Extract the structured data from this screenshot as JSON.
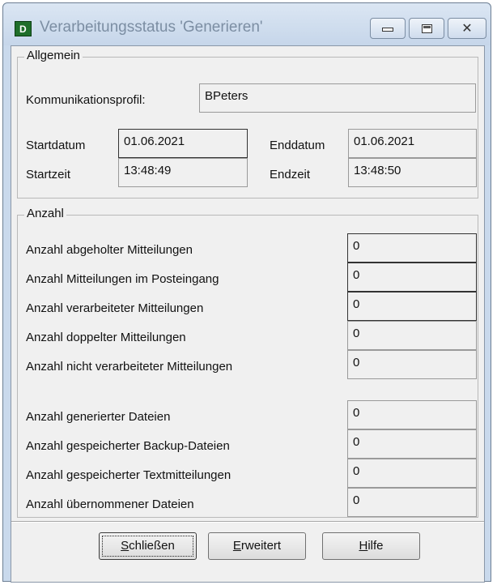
{
  "window": {
    "title": "Verarbeitungsstatus 'Generieren'",
    "app_icon_letter": "D"
  },
  "general": {
    "group_title": "Allgemein",
    "profile_label": "Kommunikationsprofil:",
    "profile_value": "BPeters",
    "start_date_label": "Startdatum",
    "start_date_value": "01.06.2021",
    "end_date_label": "Enddatum",
    "end_date_value": "01.06.2021",
    "start_time_label": "Startzeit",
    "start_time_value": "13:48:49",
    "end_time_label": "Endzeit",
    "end_time_value": "13:48:50"
  },
  "count": {
    "group_title": "Anzahl",
    "rows": [
      {
        "label": "Anzahl abgeholter Mitteilungen",
        "value": "0"
      },
      {
        "label": "Anzahl Mitteilungen im Posteingang",
        "value": "0"
      },
      {
        "label": "Anzahl verarbeiteter Mitteilungen",
        "value": "0"
      },
      {
        "label": "Anzahl doppelter Mitteilungen",
        "value": "0"
      },
      {
        "label": "Anzahl nicht verarbeiteter Mitteilungen",
        "value": "0"
      },
      {
        "label": "Anzahl generierter Dateien",
        "value": "0"
      },
      {
        "label": "Anzahl gespeicherter Backup-Dateien",
        "value": "0"
      },
      {
        "label": "Anzahl gespeicherter Textmitteilungen",
        "value": "0"
      },
      {
        "label": "Anzahl übernommener Dateien",
        "value": "0"
      }
    ]
  },
  "buttons": {
    "close": {
      "mnemonic": "S",
      "rest": "chließen"
    },
    "advanced": {
      "mnemonic": "E",
      "rest": "rweitert"
    },
    "help": {
      "mnemonic": "H",
      "rest": "ilfe"
    }
  }
}
